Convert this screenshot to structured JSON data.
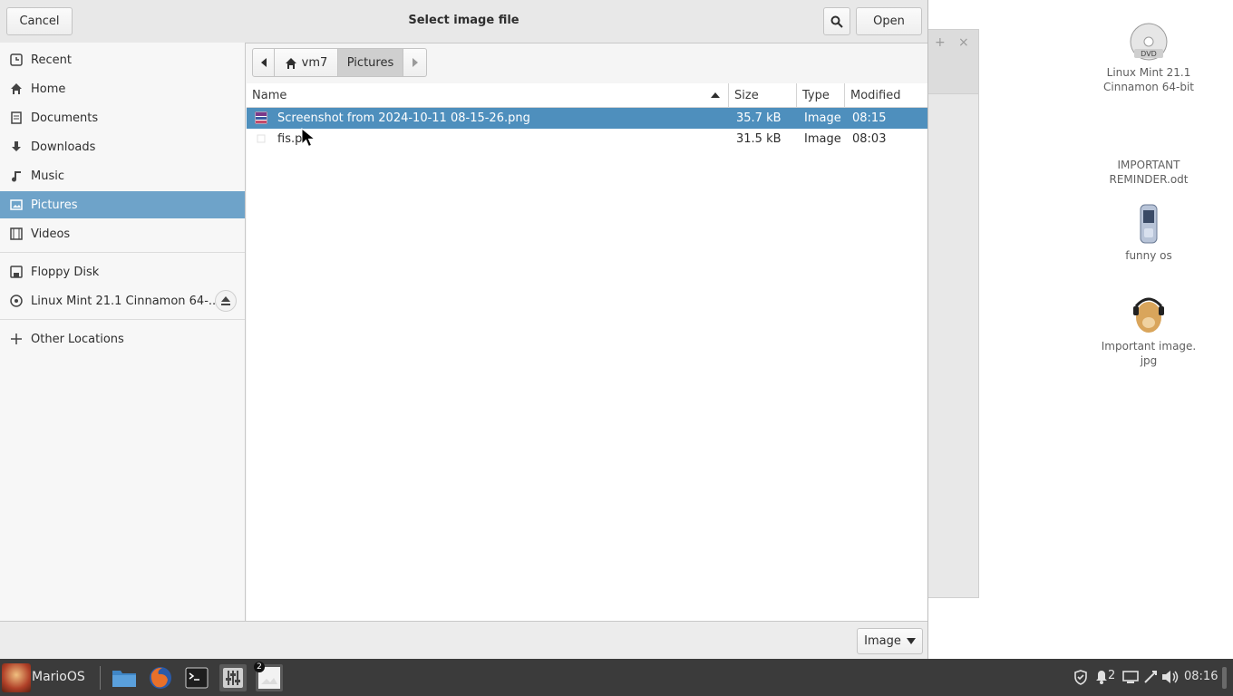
{
  "dialog": {
    "title": "Select image file",
    "cancel_label": "Cancel",
    "open_label": "Open",
    "filter_label": "Image"
  },
  "sidebar": {
    "items": [
      {
        "label": "Recent",
        "icon": "recent-icon"
      },
      {
        "label": "Home",
        "icon": "home-icon"
      },
      {
        "label": "Documents",
        "icon": "documents-icon"
      },
      {
        "label": "Downloads",
        "icon": "downloads-icon"
      },
      {
        "label": "Music",
        "icon": "music-icon"
      },
      {
        "label": "Pictures",
        "icon": "pictures-icon",
        "selected": true
      },
      {
        "label": "Videos",
        "icon": "videos-icon"
      }
    ],
    "devices": [
      {
        "label": "Floppy Disk",
        "icon": "floppy-icon"
      },
      {
        "label": "Linux Mint 21.1 Cinnamon 64-...",
        "icon": "disc-icon"
      }
    ],
    "other_locations": "Other Locations"
  },
  "pathbar": {
    "home": "vm7",
    "current": "Pictures"
  },
  "filelist": {
    "columns": [
      "Name",
      "Size",
      "Type",
      "Modified"
    ],
    "sort_column": "Name",
    "rows": [
      {
        "name": "Screenshot from 2024-10-11 08-15-26.png",
        "size": "35.7 kB",
        "type": "Image",
        "modified": "08:15",
        "selected": true
      },
      {
        "name": "fis.p",
        "size": "31.5 kB",
        "type": "Image",
        "modified": "08:03",
        "selected": false
      }
    ]
  },
  "desktop": {
    "icons": [
      {
        "label_line1": "Linux Mint 21.1",
        "label_line2": "Cinnamon 64-bit",
        "icon": "dvd-icon"
      },
      {
        "label_line1": "IMPORTANT",
        "label_line2": "REMINDER.odt",
        "icon": "document-icon"
      },
      {
        "label_line1": "funny os",
        "label_line2": "",
        "icon": "phone-icon"
      },
      {
        "label_line1": "Important image.",
        "label_line2": "jpg",
        "icon": "dog-image-icon"
      }
    ]
  },
  "taskbar": {
    "menu_label": "MarioOS",
    "workspace_badge": "2",
    "notification_count": "2",
    "clock": "08:16"
  },
  "colors": {
    "selection": "#4e8fbd",
    "sidebar_selection": "#6ea3c9",
    "taskbar": "#3b3b3b"
  }
}
